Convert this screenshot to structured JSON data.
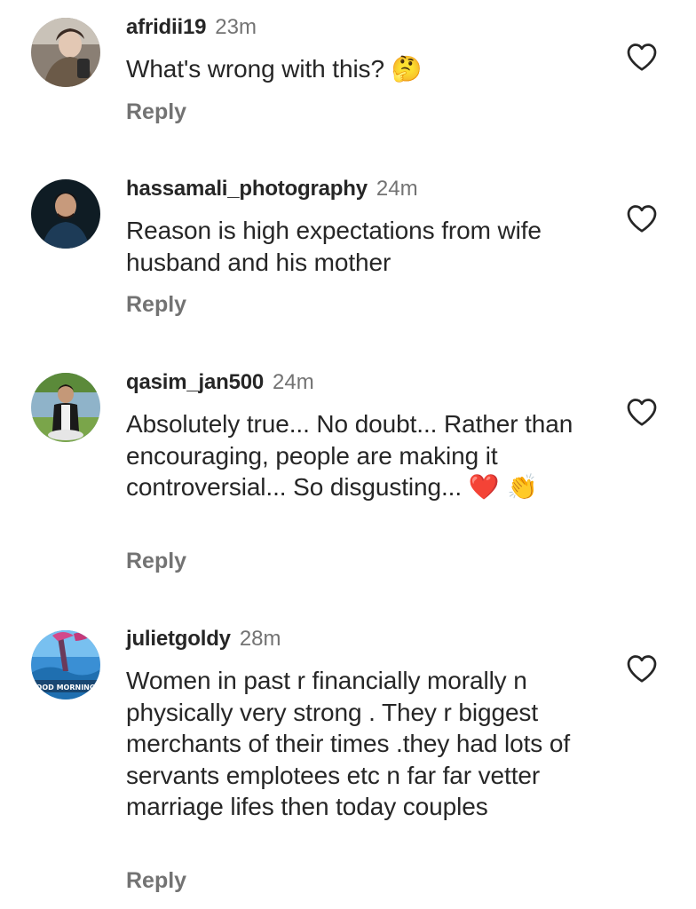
{
  "colors": {
    "background": "#ffffff",
    "primary_text": "#262626",
    "secondary_text": "#737373"
  },
  "comments": [
    {
      "username": "afridii19",
      "time": "23m",
      "text": "What's wrong with this?",
      "emoji": "🤔",
      "reply_label": "Reply",
      "avatar_icon": "avatar-photo",
      "like_icon": "heart-outline-icon"
    },
    {
      "username": "hassamali_photography",
      "time": "24m",
      "text": "Reason is high expectations from wife husband and his mother",
      "emoji": "",
      "reply_label": "Reply",
      "avatar_icon": "avatar-photo",
      "like_icon": "heart-outline-icon"
    },
    {
      "username": "qasim_jan500",
      "time": "24m",
      "text": "Absolutely true... No doubt... Rather than encouraging, people are making it controversial... So disgusting...",
      "emoji": "❤️ 👏",
      "reply_label": "Reply",
      "avatar_icon": "avatar-photo",
      "like_icon": "heart-outline-icon"
    },
    {
      "username": "julietgoldy",
      "time": "28m",
      "text": "Women in past r financially morally n physically very strong . They r biggest merchants of their times .they had lots of servants emplotees etc n far far vetter marriage lifes then today couples",
      "emoji": "",
      "reply_label": "Reply",
      "avatar_icon": "avatar-photo",
      "avatar_caption": "OOD MORNING",
      "like_icon": "heart-outline-icon"
    }
  ]
}
